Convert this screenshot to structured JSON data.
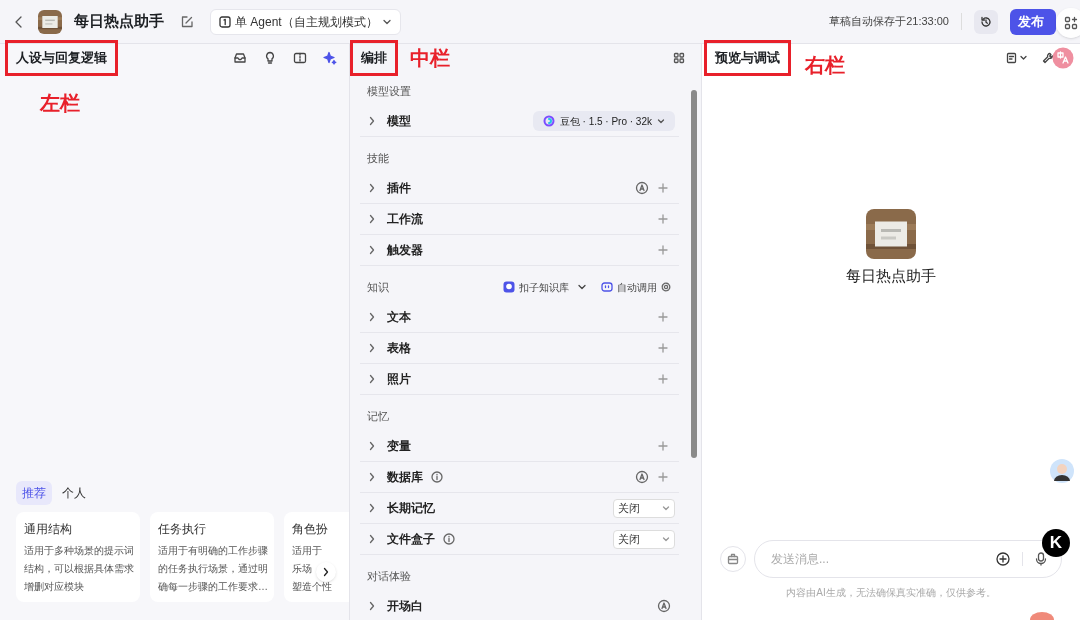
{
  "header": {
    "title": "每日热点助手",
    "mode": "单 Agent（自主规划模式）",
    "save_status": "草稿自动保存于21:33:00",
    "publish": "发布"
  },
  "left_panel": {
    "title": "人设与回复逻辑",
    "annotation": "左栏",
    "template_tabs": [
      {
        "label": "推荐",
        "selected": true
      },
      {
        "label": "个人",
        "selected": false
      }
    ],
    "templates": [
      {
        "title": "通用结构",
        "lines": [
          "适用于多种场景的提示词",
          "结构，可以根据具体需求",
          "增删对应模块"
        ]
      },
      {
        "title": "任务执行",
        "lines": [
          "适用于有明确的工作步骤",
          "的任务执行场景，通过明",
          "确每一步骤的工作要求…"
        ]
      },
      {
        "title": "角色扮",
        "lines": [
          "适用于",
          "乐场",
          "塑造个性"
        ]
      }
    ]
  },
  "middle_panel": {
    "title": "编排",
    "annotation": "中栏",
    "sections": [
      {
        "title": "模型设置",
        "items": [
          {
            "label": "模型",
            "kind": "model",
            "value": "豆包 · 1.5 · Pro · 32k",
            "info": false
          }
        ]
      },
      {
        "title": "技能",
        "items": [
          {
            "label": "插件",
            "kind": "auto_add",
            "info": false
          },
          {
            "label": "工作流",
            "kind": "add",
            "info": false
          },
          {
            "label": "触发器",
            "kind": "add",
            "info": false
          }
        ]
      },
      {
        "title": "知识",
        "library": "扣子知识库",
        "call_mode": "自动调用",
        "items": [
          {
            "label": "文本",
            "kind": "add",
            "info": false
          },
          {
            "label": "表格",
            "kind": "add",
            "info": false
          },
          {
            "label": "照片",
            "kind": "add",
            "info": false
          }
        ]
      },
      {
        "title": "记忆",
        "items": [
          {
            "label": "变量",
            "kind": "add",
            "info": false
          },
          {
            "label": "数据库",
            "kind": "auto_add",
            "info": true
          },
          {
            "label": "长期记忆",
            "kind": "select",
            "value": "关闭",
            "info": false
          },
          {
            "label": "文件盒子",
            "kind": "select",
            "value": "关闭",
            "info": true
          }
        ]
      },
      {
        "title": "对话体验",
        "items": [
          {
            "label": "开场白",
            "kind": "auto",
            "info": false
          }
        ]
      }
    ]
  },
  "right_panel": {
    "title": "预览与调试",
    "annotation": "右栏",
    "bot_name": "每日热点助手",
    "input_placeholder": "发送消息...",
    "disclaimer": "内容由AI生成，无法确保真实准确，仅供参考。"
  },
  "floating": {
    "badge": "K"
  }
}
